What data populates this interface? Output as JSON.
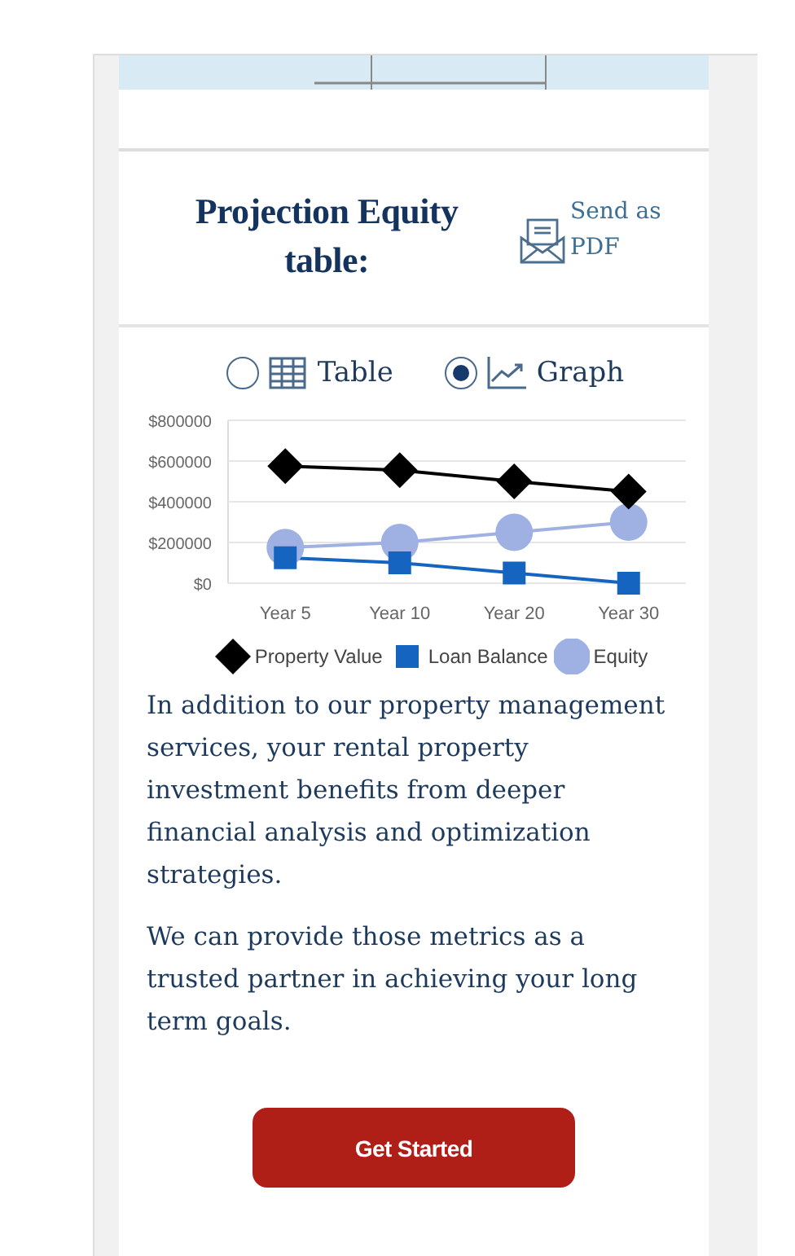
{
  "header": {
    "title": "Projection Equity table:",
    "send_link": "Send as PDF"
  },
  "view_options": [
    {
      "label": "Table",
      "kind": "table",
      "selected": false
    },
    {
      "label": "Graph",
      "kind": "graph",
      "selected": true
    }
  ],
  "chart": {
    "chart_data": {
      "type": "line",
      "grid": true,
      "categories": [
        "Year 5",
        "Year 10",
        "Year 20",
        "Year 30"
      ],
      "ylim": [
        0,
        800000
      ],
      "yticks": [
        {
          "value": 0,
          "label": "$0"
        },
        {
          "value": 200000,
          "label": "$200000"
        },
        {
          "value": 400000,
          "label": "$400000"
        },
        {
          "value": 600000,
          "label": "$600000"
        },
        {
          "value": 800000,
          "label": "$800000"
        }
      ],
      "series": [
        {
          "name": "Property Value",
          "color": "#000000",
          "marker": "diamond",
          "values": [
            575000,
            555000,
            500000,
            450000
          ]
        },
        {
          "name": "Loan Balance",
          "color": "#1565c0",
          "marker": "square",
          "values": [
            125000,
            100000,
            50000,
            0
          ]
        },
        {
          "name": "Equity",
          "color": "#9fb0e3",
          "marker": "circle",
          "values": [
            175000,
            200000,
            250000,
            300000
          ]
        }
      ]
    }
  },
  "paragraphs": [
    "In addition to our property management services, your rental property investment benefits from deeper financial analysis and optimization strategies.",
    "We can provide those metrics as a trusted partner in achieving your long term goals."
  ],
  "cta": {
    "label": "Get Started"
  }
}
